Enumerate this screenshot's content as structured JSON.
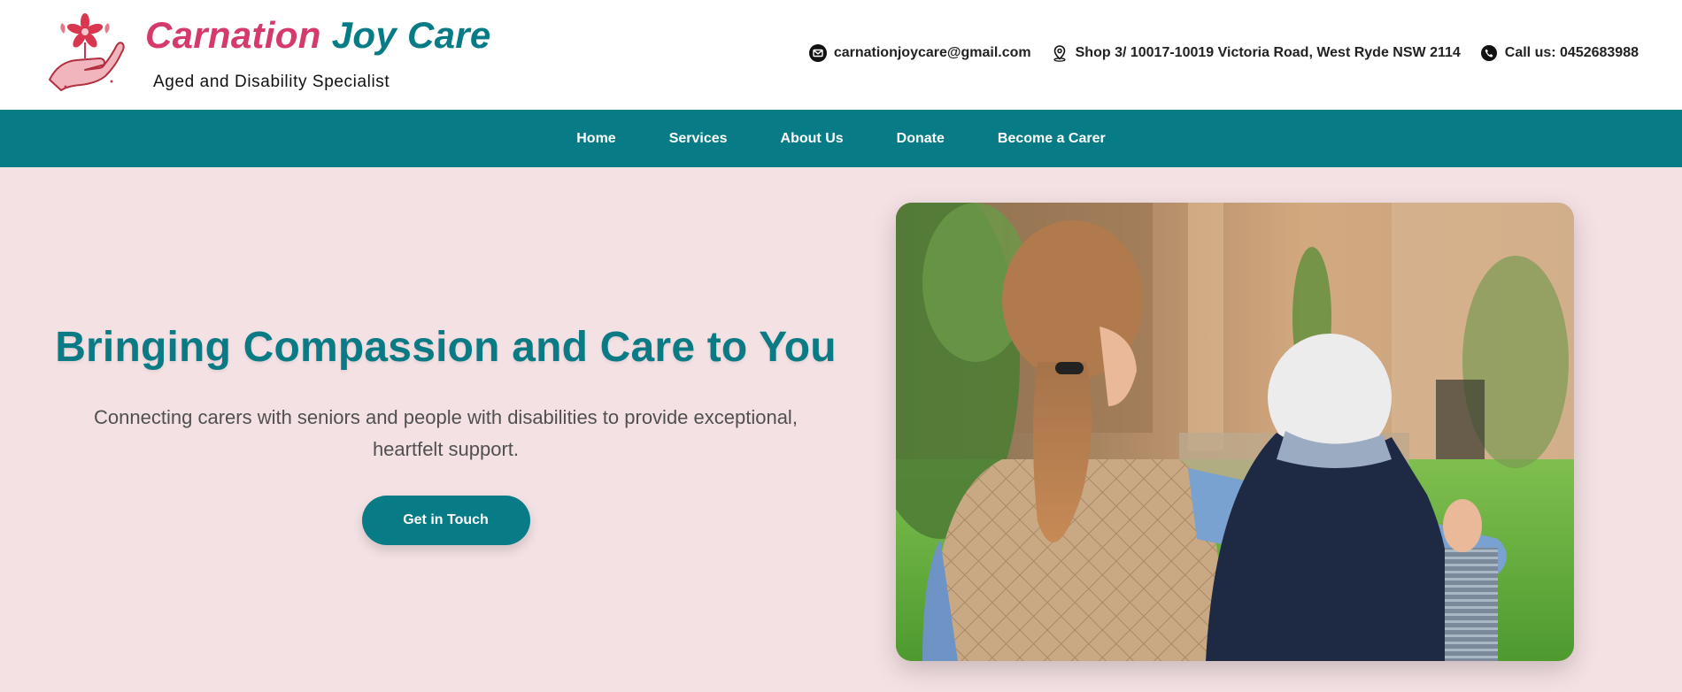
{
  "header": {
    "brand_part1": "Carnation",
    "brand_part2": "Joy Care",
    "tagline": "Aged and Disability Specialist",
    "logo_icon": "hand-holding-flower-icon",
    "email": "carnationjoycare@gmail.com",
    "address": "Shop 3/ 10017-10019 Victoria Road, West Ryde NSW 2114",
    "phone": "Call us: 0452683988",
    "email_icon": "envelope-icon",
    "address_icon": "map-pin-icon",
    "phone_icon": "phone-icon"
  },
  "nav": {
    "items": [
      {
        "label": "Home"
      },
      {
        "label": "Services"
      },
      {
        "label": "About Us"
      },
      {
        "label": "Donate"
      },
      {
        "label": "Become a Carer"
      }
    ]
  },
  "hero": {
    "title": "Bringing Compassion and Care to You",
    "subtitle": "Connecting carers with seniors and people with disabilities to provide exceptional, heartfelt support.",
    "cta_label": "Get in Touch",
    "image_icon": "carer-with-elderly-person-photo"
  },
  "colors": {
    "brand_pink": "#d63a6a",
    "brand_teal": "#087c86",
    "nav_bg": "#077b86",
    "hero_bg": "#f4e1e3"
  }
}
